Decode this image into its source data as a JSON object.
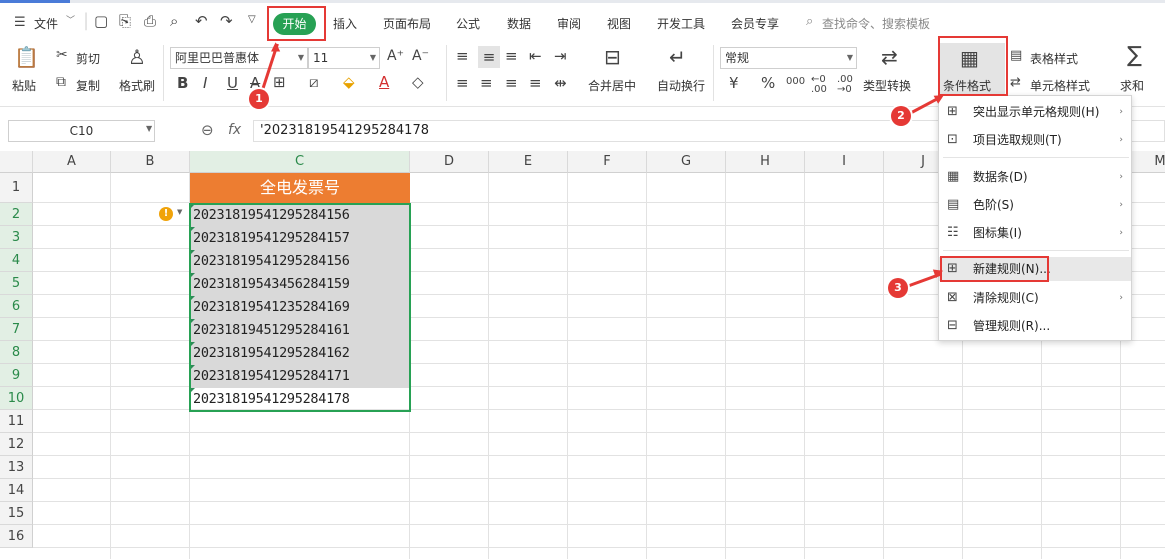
{
  "menubar": {
    "file_label": "文件",
    "start_tab": "开始",
    "tabs": [
      "插入",
      "页面布局",
      "公式",
      "数据",
      "审阅",
      "视图",
      "开发工具",
      "会员专享"
    ],
    "search_placeholder": "查找命令、搜索模板"
  },
  "ribbon": {
    "paste": "粘贴",
    "cut": "剪切",
    "copy": "复制",
    "format_painter": "格式刷",
    "font_name": "阿里巴巴普惠体",
    "font_size": "11",
    "bold": "B",
    "italic": "I",
    "underline": "U",
    "font_color_letter": "A",
    "merge_center": "合并居中",
    "wrap_text": "自动换行",
    "number_format": "常规",
    "percent": "%",
    "thousands": "000",
    "type_convert": "类型转换",
    "conditional_format": "条件格式",
    "table_style": "表格样式",
    "cell_style": "单元格样式",
    "sum": "求和"
  },
  "formula_bar": {
    "name_box": "C10",
    "fx": "fx",
    "content": "'20231819541295284178"
  },
  "sheet": {
    "columns": [
      "A",
      "B",
      "C",
      "D",
      "E",
      "F",
      "G",
      "H",
      "I",
      "J",
      "M"
    ],
    "rows": [
      "1",
      "2",
      "3",
      "4",
      "5",
      "6",
      "7",
      "8",
      "9",
      "10",
      "11",
      "12",
      "13",
      "14",
      "15",
      "16"
    ],
    "header_cell": "全电发票号",
    "values": [
      "20231819541295284156",
      "20231819541295284157",
      "20231819541295284156",
      "20231819543456284159",
      "20231819541235284169",
      "20231819451295284161",
      "20231819541295284162",
      "20231819541295284171",
      "20231819541295284178"
    ]
  },
  "cf_menu": {
    "items": [
      {
        "label": "突出显示单元格规则(H)",
        "icon": "highlight-rules-icon",
        "sub": "›"
      },
      {
        "label": "项目选取规则(T)",
        "icon": "top-rules-icon",
        "sub": "›"
      },
      {
        "label": "数据条(D)",
        "icon": "data-bar-icon",
        "sub": "›"
      },
      {
        "label": "色阶(S)",
        "icon": "color-scale-icon",
        "sub": "›"
      },
      {
        "label": "图标集(I)",
        "icon": "icon-set-icon",
        "sub": "›"
      },
      {
        "label": "新建规则(N)...",
        "icon": "new-rule-icon",
        "sub": ""
      },
      {
        "label": "清除规则(C)",
        "icon": "clear-rules-icon",
        "sub": "›"
      },
      {
        "label": "管理规则(R)...",
        "icon": "manage-rules-icon",
        "sub": ""
      }
    ]
  },
  "annotations": {
    "step1": "1",
    "step2": "2",
    "step3": "3",
    "color": "#e53935"
  },
  "colors": {
    "accent_green": "#27a154",
    "header_orange": "#ed7d31",
    "cell_gray": "#d9d9d9"
  }
}
